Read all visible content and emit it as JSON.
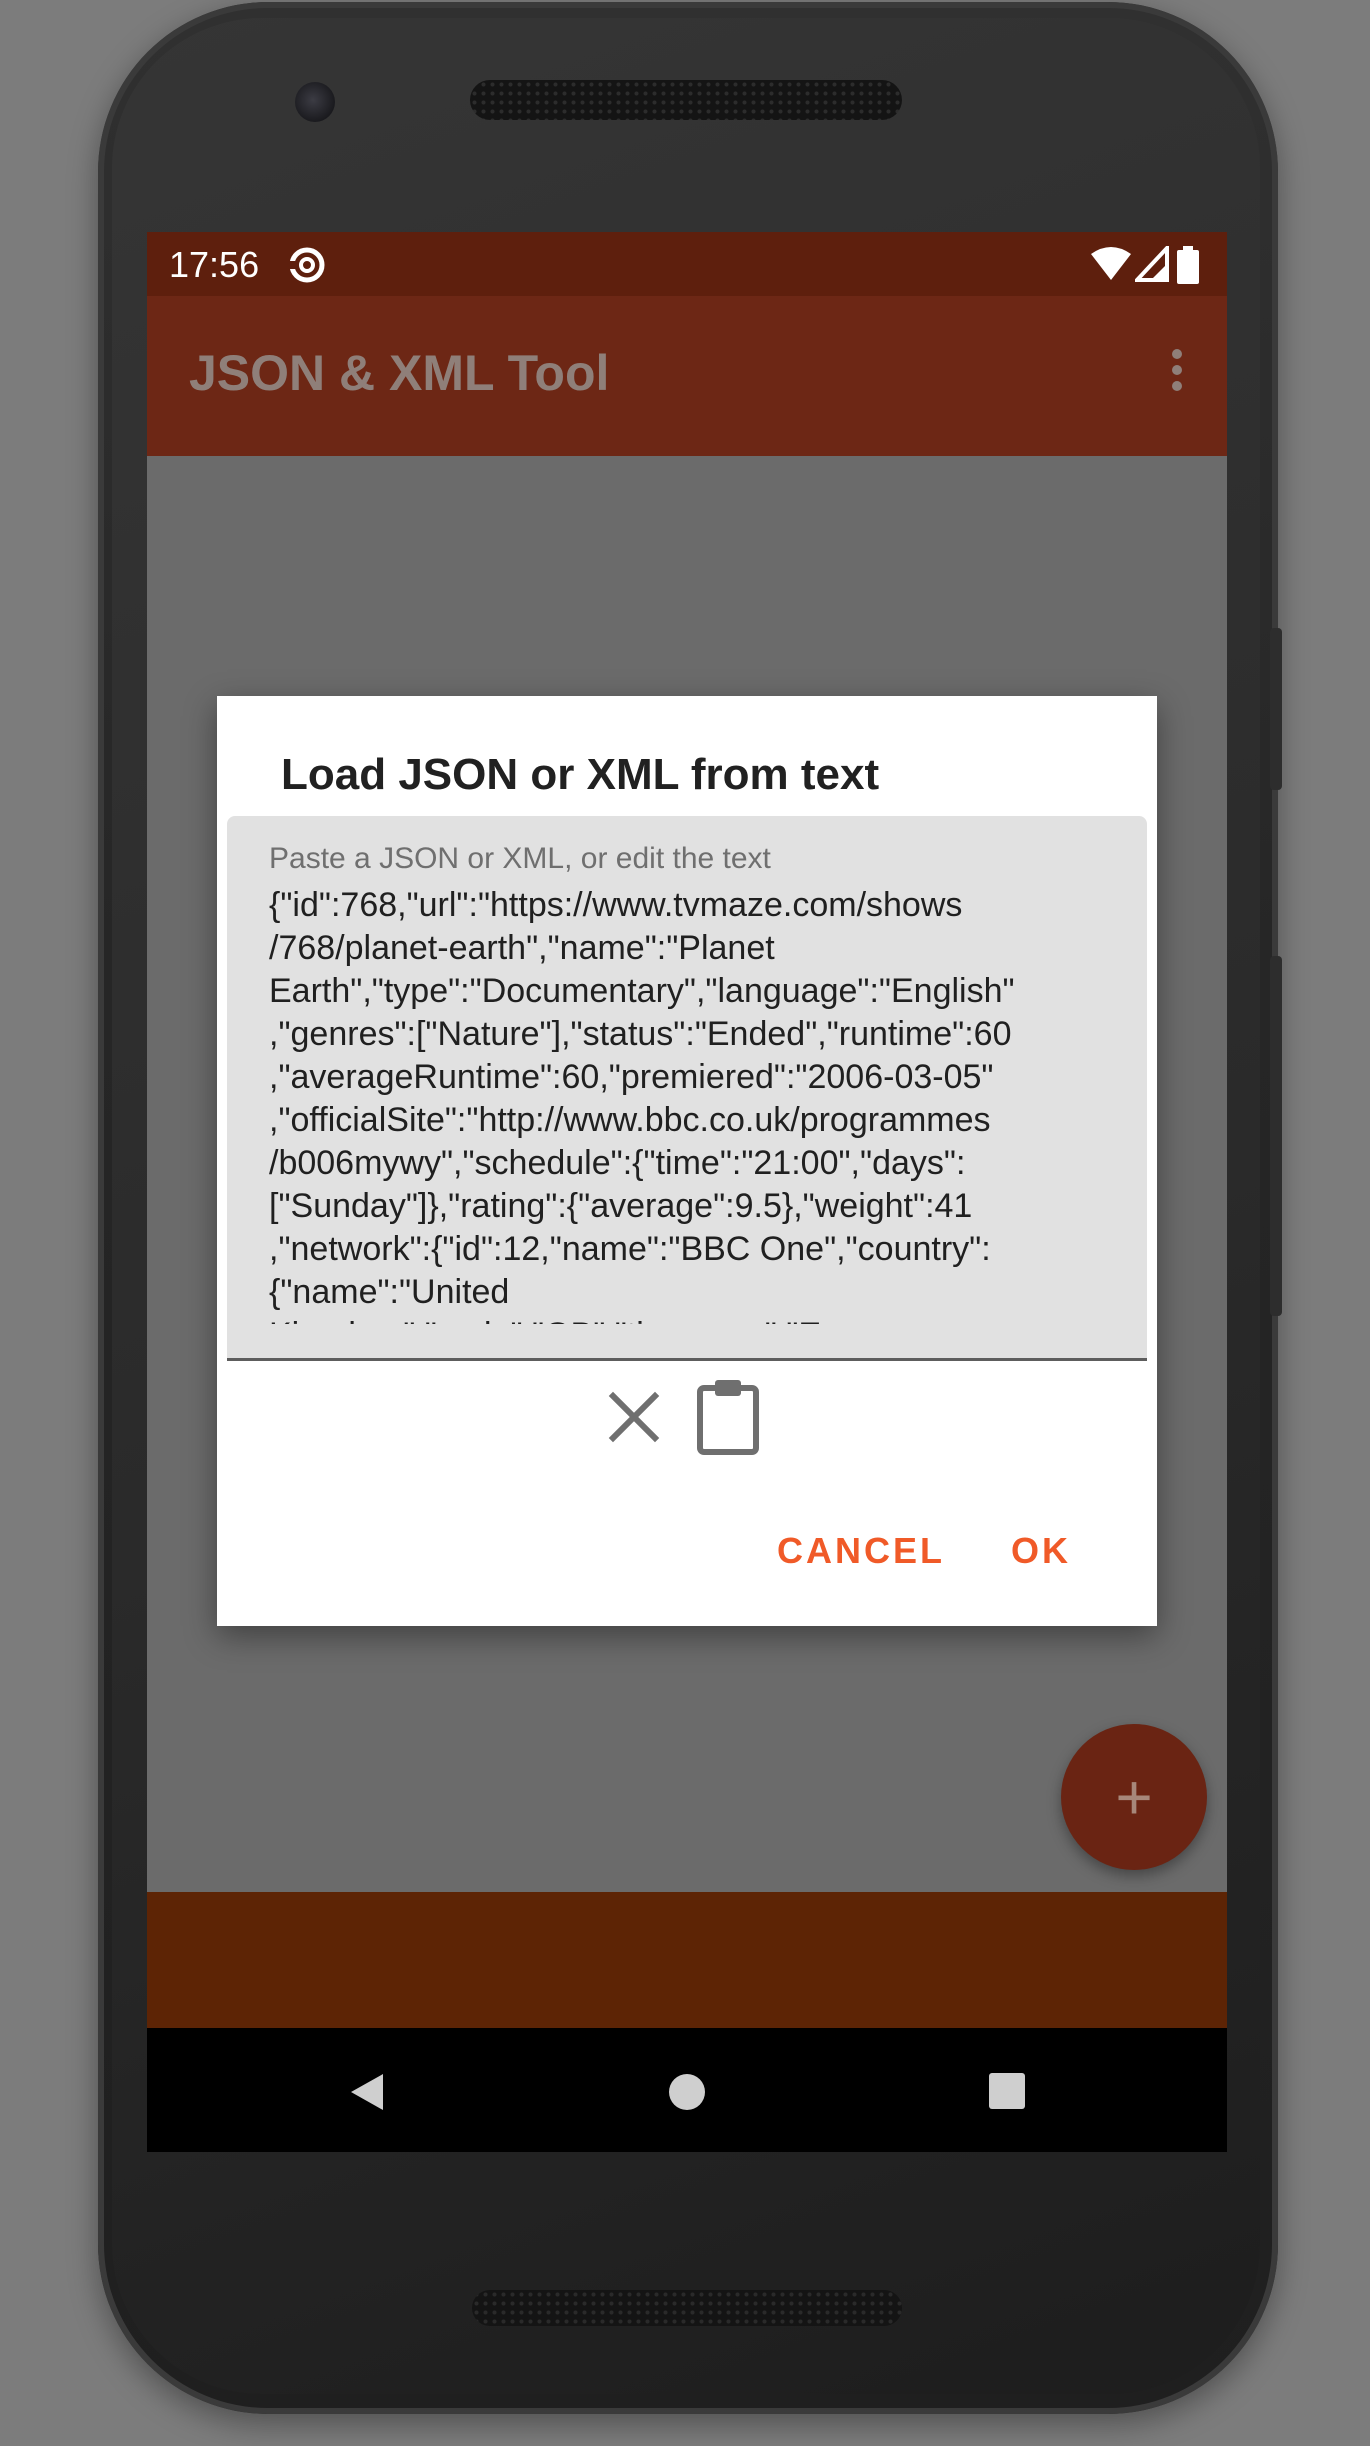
{
  "status_bar": {
    "time": "17:56"
  },
  "app_bar": {
    "title": "JSON & XML Tool"
  },
  "dialog": {
    "title": "Load JSON or XML from text",
    "input_hint": "Paste a JSON or XML, or edit the text",
    "input_value": "{\"id\":768,\"url\":\"https://www.tvmaze.com/shows\n/768/planet-earth\",\"name\":\"Planet\nEarth\",\"type\":\"Documentary\",\"language\":\"English\"\n,\"genres\":[\"Nature\"],\"status\":\"Ended\",\"runtime\":60\n,\"averageRuntime\":60,\"premiered\":\"2006-03-05\"\n,\"officialSite\":\"http://www.bbc.co.uk/programmes\n/b006mywy\",\"schedule\":{\"time\":\"21:00\",\"days\":\n[\"Sunday\"]},\"rating\":{\"average\":9.5},\"weight\":41\n,\"network\":{\"id\":12,\"name\":\"BBC One\",\"country\":\n{\"name\":\"United\nKingdom\",\"code\":\"GB\",\"timezone\":\"Europe",
    "cancel_label": "CANCEL",
    "ok_label": "OK"
  },
  "fab": {
    "label": "+"
  },
  "colors": {
    "status_bar": "#5e1f0d",
    "app_bar": "#6d2715",
    "accent": "#f05a28",
    "bottom_bar": "#5d2405"
  },
  "icons": [
    "lock-rotation-icon",
    "wifi-icon",
    "signal-icon",
    "battery-icon",
    "overflow-menu-icon",
    "clear-icon",
    "clipboard-icon",
    "back-icon",
    "home-icon",
    "recents-icon"
  ]
}
